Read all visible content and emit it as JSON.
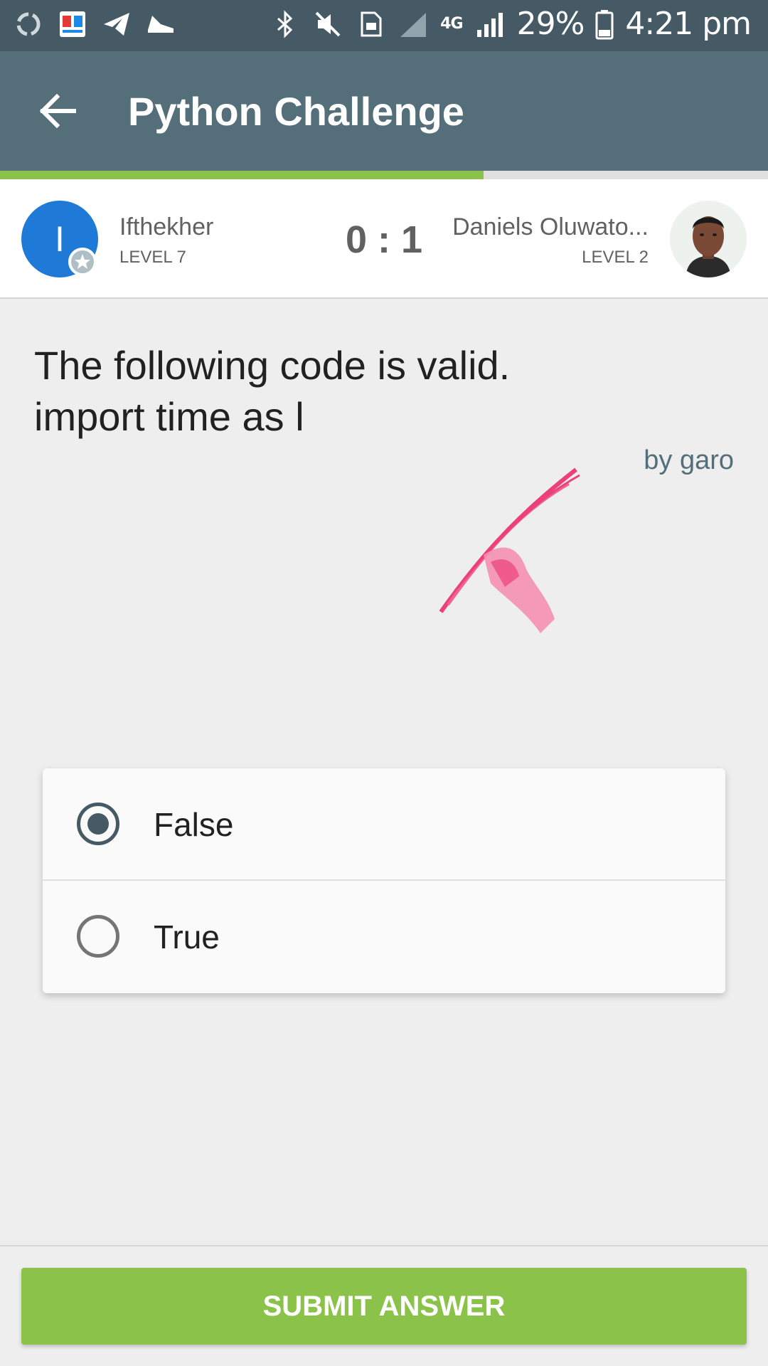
{
  "status_bar": {
    "battery": "29%",
    "time": "4:21 pm",
    "network": "4G",
    "icons": [
      "share-it-icon",
      "bangla-app-icon",
      "telegram-icon",
      "shoe-icon",
      "bluetooth-icon",
      "mute-icon",
      "sim-icon",
      "signal-icon",
      "battery-icon"
    ]
  },
  "app_bar": {
    "title": "Python Challenge",
    "progress_fraction": 0.63,
    "progress_color": "#8bc34a"
  },
  "players": {
    "left": {
      "initial": "I",
      "name": "Ifthekher",
      "level": "LEVEL 7",
      "avatar_color": "#1e7ad6"
    },
    "score": "0 : 1",
    "right": {
      "name": "Daniels Oluwato...",
      "level": "LEVEL 2"
    }
  },
  "question": {
    "text": "The following code is valid.\nimport time as l",
    "author": "by garo"
  },
  "options": [
    {
      "label": "False",
      "selected": true
    },
    {
      "label": "True",
      "selected": false
    }
  ],
  "submit_label": "SUBMIT ANSWER",
  "colors": {
    "status_bar": "#455a64",
    "app_bar": "#546e7a",
    "accent": "#8bc34a",
    "radio_selected": "#455a64"
  }
}
